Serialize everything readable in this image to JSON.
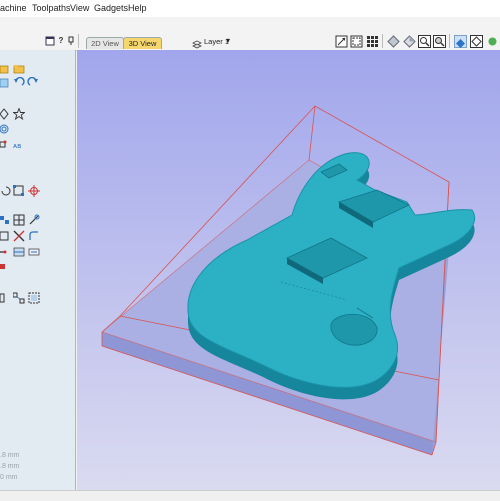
{
  "menu": {
    "items": [
      "achine",
      "Toolpaths",
      "View",
      "Gadgets",
      "Help"
    ]
  },
  "toolbar": {
    "help_icon": "?",
    "tab_2d": "2D View",
    "tab_3d": "3D View",
    "layer_label": "Layer 1",
    "layer_dropdown": "▾"
  },
  "left_panel": {
    "measurements": [
      ".8 mm",
      ".8 mm",
      "0 mm"
    ]
  },
  "colors": {
    "model": "#2bb0c4",
    "model_dark": "#16849a",
    "boundary": "#d9534f",
    "viewport_top": "#a1a6ec",
    "viewport_bottom": "#dadaf0",
    "panel": "#e2eaf2"
  }
}
